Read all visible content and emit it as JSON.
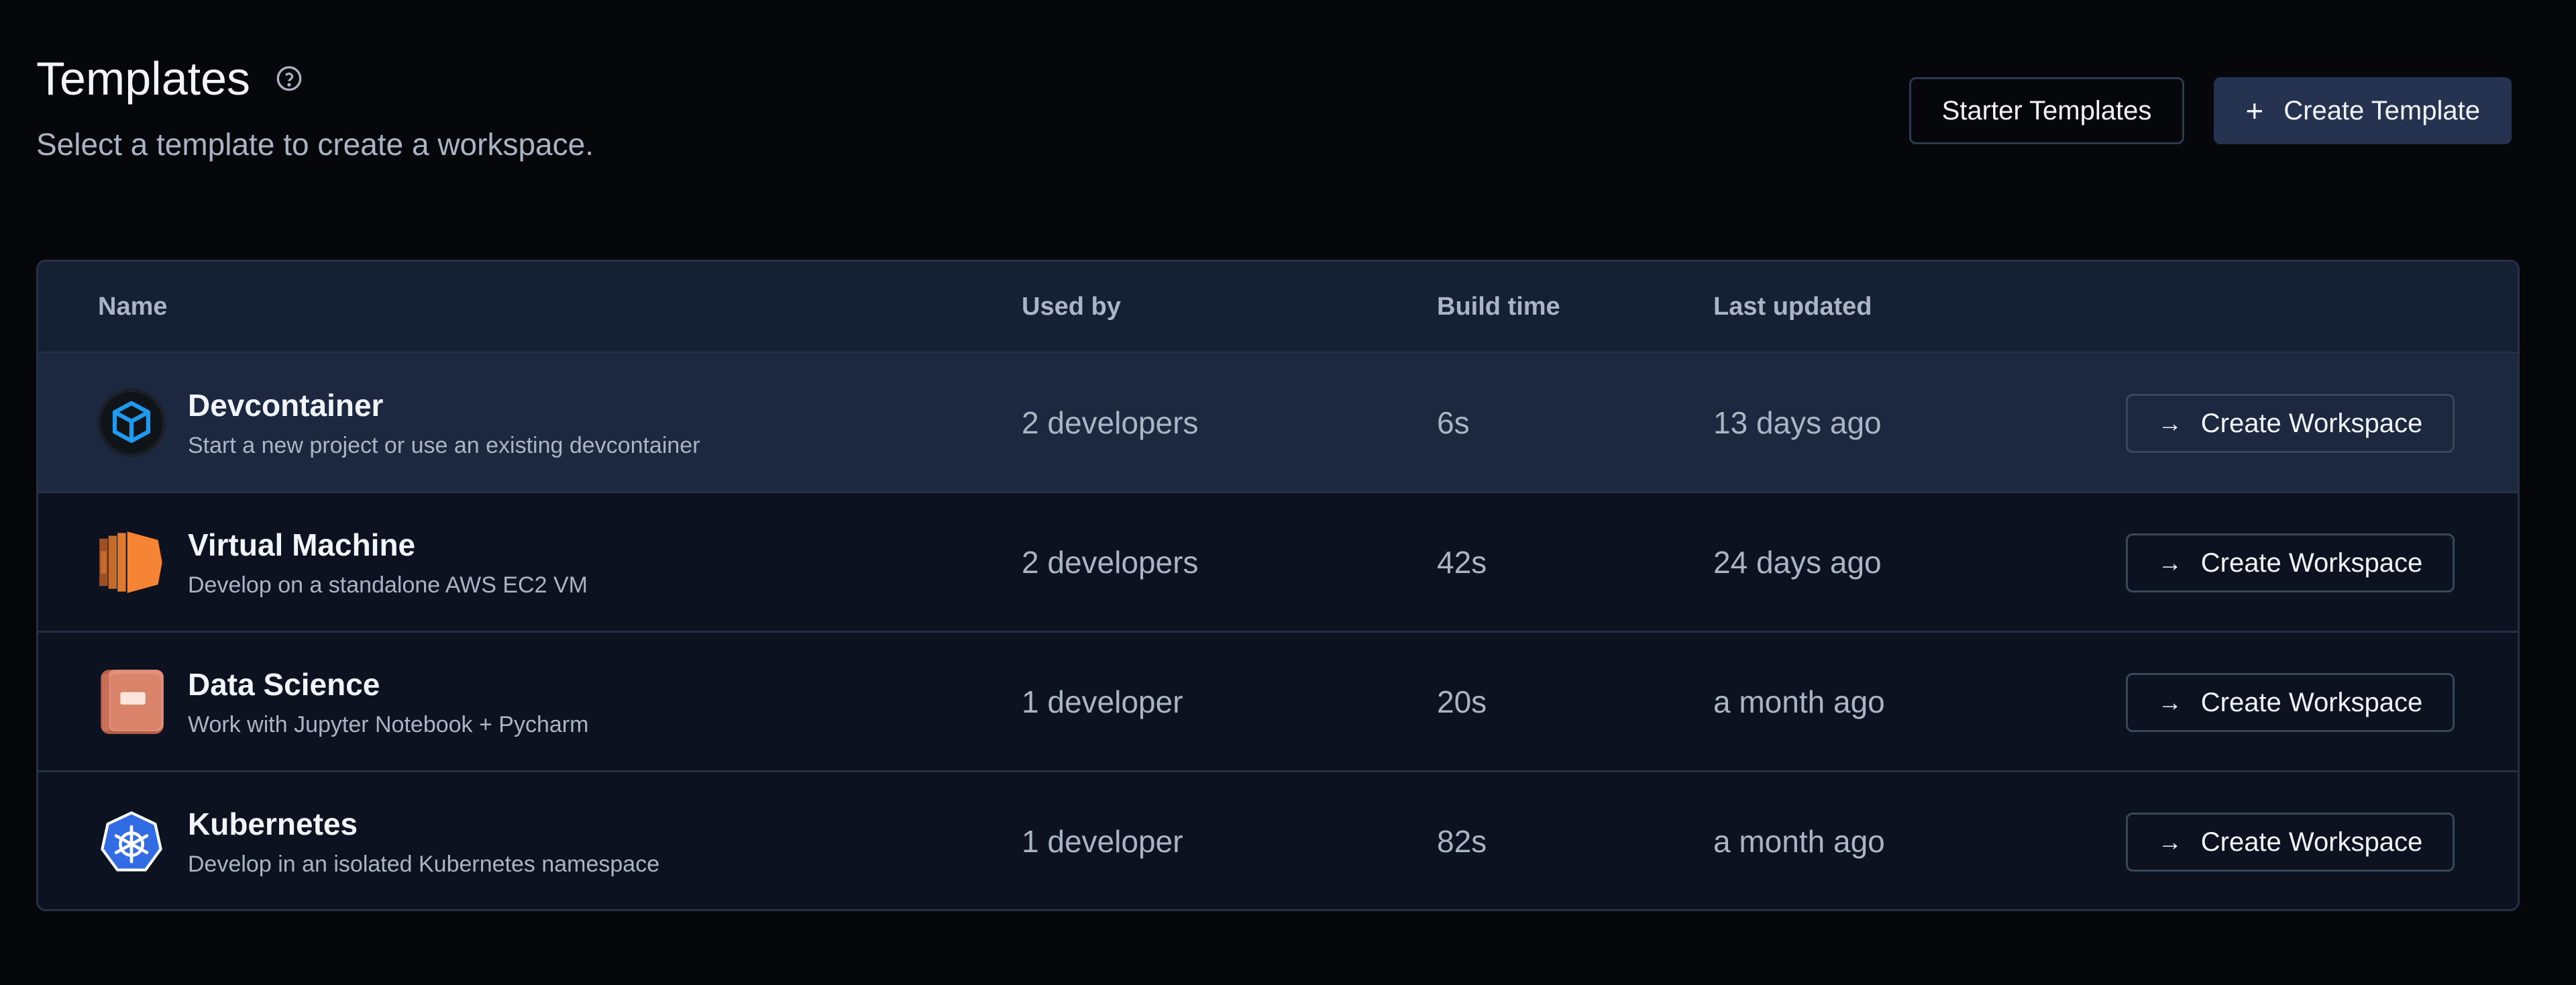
{
  "header": {
    "title": "Templates",
    "subtitle": "Select a template to create a workspace."
  },
  "actions": {
    "starter_label": "Starter Templates",
    "create_label": "Create Template",
    "create_icon": "+"
  },
  "table": {
    "columns": [
      "Name",
      "Used by",
      "Build time",
      "Last updated"
    ],
    "action_label": "Create Workspace",
    "action_icon": "→",
    "rows": [
      {
        "name": "Devcontainer",
        "description": "Start a new project or use an existing devcontainer",
        "used_by": "2 developers",
        "build_time": "6s",
        "last_updated": "13 days ago",
        "icon": "devcontainer-cube-icon"
      },
      {
        "name": "Virtual Machine",
        "description": "Develop on a standalone AWS EC2 VM",
        "used_by": "2 developers",
        "build_time": "42s",
        "last_updated": "24 days ago",
        "icon": "aws-ec2-icon"
      },
      {
        "name": "Data Science",
        "description": "Work with Jupyter Notebook + Pycharm",
        "used_by": "1 developer",
        "build_time": "20s",
        "last_updated": "a month ago",
        "icon": "notebook-icon"
      },
      {
        "name": "Kubernetes",
        "description": "Develop in an isolated Kubernetes namespace",
        "used_by": "1 developer",
        "build_time": "82s",
        "last_updated": "a month ago",
        "icon": "kubernetes-icon"
      }
    ]
  },
  "colors": {
    "background": "#05070b",
    "table_bg": "#0c1220",
    "header_bg": "#162033",
    "hover_row": "#1c2840",
    "primary_button": "#263350",
    "devcontainer_blue": "#1e9bf0",
    "aws_orange": "#f58534",
    "notebook_brown": "#d9836a",
    "kubernetes_blue": "#326ce5"
  }
}
